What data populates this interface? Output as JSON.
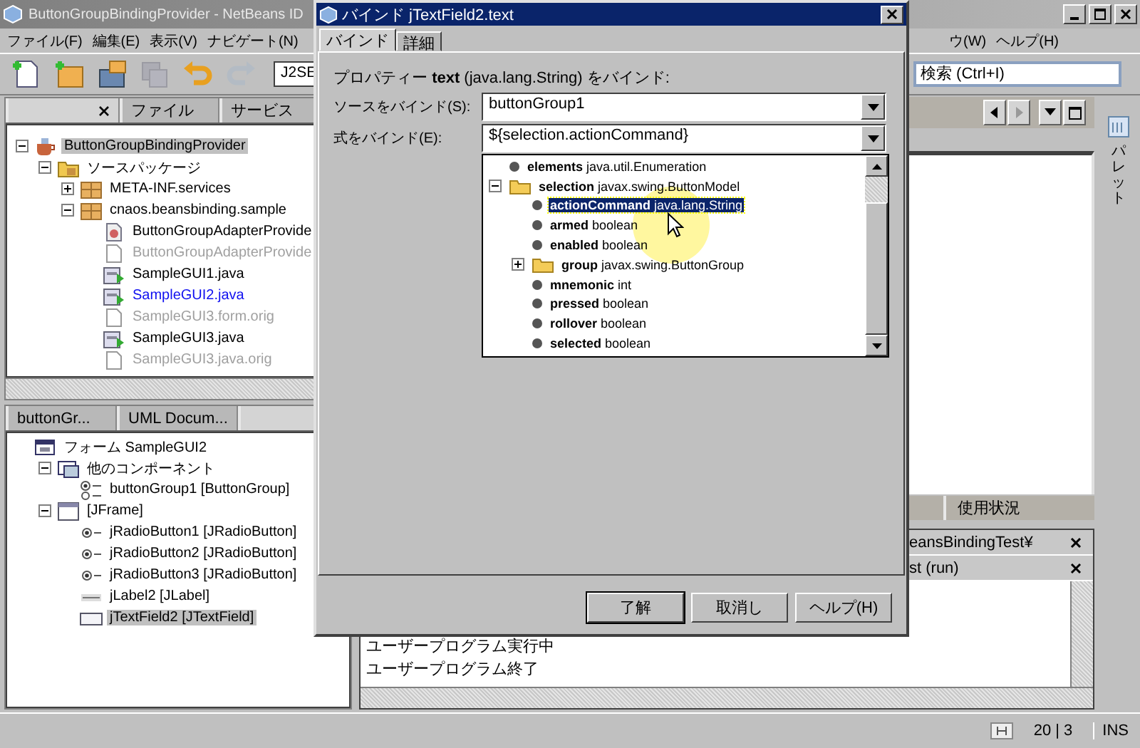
{
  "window": {
    "title": "ButtonGroupBindingProvider - NetBeans ID"
  },
  "menu": [
    "ファイル(F)",
    "編集(E)",
    "表示(V)",
    "ナビゲート(N)"
  ],
  "menu_right": [
    "ウ(W)",
    "ヘルプ(H)"
  ],
  "toolbar": {
    "buttons": [
      {
        "kind": "new-file",
        "disabled": false
      },
      {
        "kind": "new-project",
        "disabled": false
      },
      {
        "kind": "open-project",
        "disabled": false
      },
      {
        "kind": "save-all",
        "disabled": true
      },
      {
        "kind": "undo",
        "disabled": false
      },
      {
        "kind": "redo",
        "disabled": true
      }
    ],
    "config": "J2SE",
    "search": {
      "placeholder": "検索 (Ctrl+I)"
    }
  },
  "projects_panel": {
    "tabs": [
      {
        "selected": true
      },
      {
        "label": "ファイル",
        "selected": false
      },
      {
        "label": "サービス",
        "selected": false
      }
    ],
    "tree": [
      {
        "label": "ButtonGroupBindingProvider",
        "kind": "project",
        "expanded": true,
        "selected": true,
        "muted": false,
        "modified": false,
        "children": [
          {
            "label": "ソースパッケージ",
            "kind": "source-root",
            "expanded": true,
            "selected": false,
            "muted": false,
            "modified": false,
            "children": [
              {
                "label": "META-INF.services",
                "kind": "package",
                "expanded": false,
                "selected": false,
                "muted": false,
                "modified": false
              },
              {
                "label": "cnaos.beansbinding.sample",
                "kind": "package",
                "expanded": true,
                "selected": false,
                "muted": false,
                "modified": false,
                "children": [
                  {
                    "label": "ButtonGroupAdapterProvide",
                    "kind": "class",
                    "selected": false,
                    "muted": false,
                    "modified": false
                  },
                  {
                    "label": "ButtonGroupAdapterProvide",
                    "kind": "file",
                    "selected": false,
                    "muted": true,
                    "modified": false
                  },
                  {
                    "label": "SampleGUI1.java",
                    "kind": "form-java",
                    "selected": false,
                    "muted": false,
                    "modified": false
                  },
                  {
                    "label": "SampleGUI2.java",
                    "kind": "form-java",
                    "selected": false,
                    "muted": false,
                    "modified": true
                  },
                  {
                    "label": "SampleGUI3.form.orig",
                    "kind": "file",
                    "selected": false,
                    "muted": true,
                    "modified": false
                  },
                  {
                    "label": "SampleGUI3.java",
                    "kind": "form-java",
                    "selected": false,
                    "muted": false,
                    "modified": false
                  },
                  {
                    "label": "SampleGUI3.java.orig",
                    "kind": "file",
                    "selected": false,
                    "muted": true,
                    "modified": false
                  }
                ]
              }
            ]
          }
        ]
      }
    ]
  },
  "inspector_panel": {
    "tabs": [
      {
        "label": "buttonGr...",
        "selected": false
      },
      {
        "label": "UML Docum...",
        "selected": false
      },
      {
        "selected": true
      }
    ],
    "tree": [
      {
        "label": "フォーム SampleGUI2",
        "kind": "form",
        "selected": false,
        "children": [
          {
            "label": "他のコンポーネント",
            "kind": "components",
            "expanded": true,
            "selected": false,
            "children": [
              {
                "label": "buttonGroup1 [ButtonGroup]",
                "kind": "button-group",
                "selected": false
              }
            ]
          },
          {
            "label": "[JFrame]",
            "kind": "frame",
            "expanded": true,
            "selected": false,
            "children": [
              {
                "label": "jRadioButton1 [JRadioButton]",
                "kind": "radio",
                "selected": false
              },
              {
                "label": "jRadioButton2 [JRadioButton]",
                "kind": "radio",
                "selected": false
              },
              {
                "label": "jRadioButton3 [JRadioButton]",
                "kind": "radio",
                "selected": false
              },
              {
                "label": "jLabel2 [JLabel]",
                "kind": "label",
                "selected": false
              },
              {
                "label": "jTextField2 [JTextField]",
                "kind": "textfield",
                "selected": true
              }
            ]
          }
        ]
      }
    ]
  },
  "output": {
    "tabs": [
      {
        "label": "使用状況",
        "selected": false
      }
    ],
    "sessions": [
      {
        "label": "eansBindingTest¥"
      },
      {
        "label": "st (run)"
      }
    ],
    "lines": [
      "ユーザープログラム実行中",
      "ユーザープログラム終了"
    ]
  },
  "palette": {
    "label": "パレット"
  },
  "status_bar": {
    "position": "20 | 3",
    "mode": "INS"
  },
  "dialog": {
    "title": "バインド jTextField2.text",
    "tabs": [
      {
        "label": "バインド",
        "selected": true
      },
      {
        "label": "詳細",
        "selected": false
      }
    ],
    "property_label": "プロパティー **text** (java.lang.String) をバインド:",
    "source": {
      "label": "ソースをバインド(S):",
      "value": "buttonGroup1"
    },
    "expression": {
      "label": "式をバインド(E):",
      "value": "${selection.actionCommand}"
    },
    "expression_tree": [
      {
        "name": "elements",
        "type": "java.util.Enumeration",
        "kind": "property",
        "selected": false
      },
      {
        "name": "selection",
        "type": "javax.swing.ButtonModel",
        "kind": "folder",
        "expanded": true,
        "selected": false,
        "children": [
          {
            "name": "actionCommand",
            "type": "java.lang.String",
            "kind": "property",
            "selected": true
          },
          {
            "name": "armed",
            "type": "boolean",
            "kind": "property",
            "selected": false
          },
          {
            "name": "enabled",
            "type": "boolean",
            "kind": "property",
            "selected": false
          },
          {
            "name": "group",
            "type": "javax.swing.ButtonGroup",
            "kind": "folder",
            "expanded": false,
            "selected": false
          },
          {
            "name": "mnemonic",
            "type": "int",
            "kind": "property",
            "selected": false
          },
          {
            "name": "pressed",
            "type": "boolean",
            "kind": "property",
            "selected": false
          },
          {
            "name": "rollover",
            "type": "boolean",
            "kind": "property",
            "selected": false
          },
          {
            "name": "selected",
            "type": "boolean",
            "kind": "property",
            "selected": false
          }
        ]
      }
    ],
    "buttons": [
      {
        "label": "了解",
        "default": true
      },
      {
        "label": "取消し",
        "default": false
      },
      {
        "label": "ヘルプ(H)",
        "default": false
      }
    ]
  }
}
